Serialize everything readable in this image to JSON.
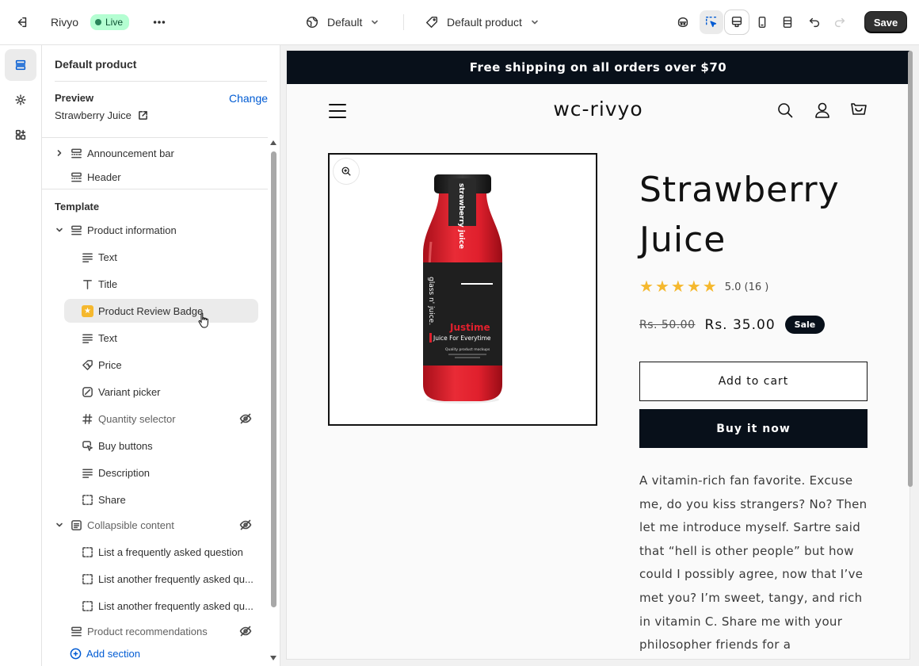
{
  "topbar": {
    "store_name": "Rivyo",
    "live_label": "Live",
    "theme_select": "Default",
    "template_select": "Default product",
    "save_label": "Save"
  },
  "sidebar": {
    "title": "Default product",
    "preview_label": "Preview",
    "change_label": "Change",
    "preview_value": "Strawberry Juice",
    "sections": [
      {
        "label": "Announcement bar"
      },
      {
        "label": "Header"
      }
    ],
    "template_heading": "Template",
    "blocks": [
      {
        "label": "Product information"
      },
      {
        "label": "Text"
      },
      {
        "label": "Title"
      },
      {
        "label": "Product Review Badge"
      },
      {
        "label": "Text"
      },
      {
        "label": "Price"
      },
      {
        "label": "Variant picker"
      },
      {
        "label": "Quantity selector"
      },
      {
        "label": "Buy buttons"
      },
      {
        "label": "Description"
      },
      {
        "label": "Share"
      },
      {
        "label": "Collapsible content"
      },
      {
        "label": "List a frequently asked question"
      },
      {
        "label": "List another frequently asked qu..."
      },
      {
        "label": "List another frequently asked qu..."
      },
      {
        "label": "Product recommendations"
      }
    ],
    "add_section": "Add section"
  },
  "store": {
    "announcement": "Free shipping on all orders over $70",
    "logo": "wc-rivyo",
    "product": {
      "title": "Strawberry Juice",
      "rating_text": "5.0 (16 )",
      "rating": 5,
      "rating_max": 5,
      "price_old": "Rs. 50.00",
      "price_new": "Rs. 35.00",
      "sale_badge": "Sale",
      "add_to_cart": "Add to cart",
      "buy_now": "Buy it now",
      "description": "A vitamin-rich fan favorite. Excuse me, do you kiss strangers? No? Then let me introduce myself. Sartre said that “hell is other people” but how could I possibly agree, now that I’ve met you? I’m sweet, tangy, and rich in vitamin C. Share me with your philosopher friends for a",
      "bottle": {
        "cap_text": "strawberry juice",
        "side_text": "glass n' juice.",
        "brand": "Justime",
        "tagline": "Juice For Everytime",
        "small": "Quality product mockups"
      }
    }
  },
  "colors": {
    "accent": "#005bd3",
    "live_bg": "#b4fed2",
    "store_dark": "#08101a",
    "star": "#f5b82e",
    "juice": "#e0202d"
  }
}
